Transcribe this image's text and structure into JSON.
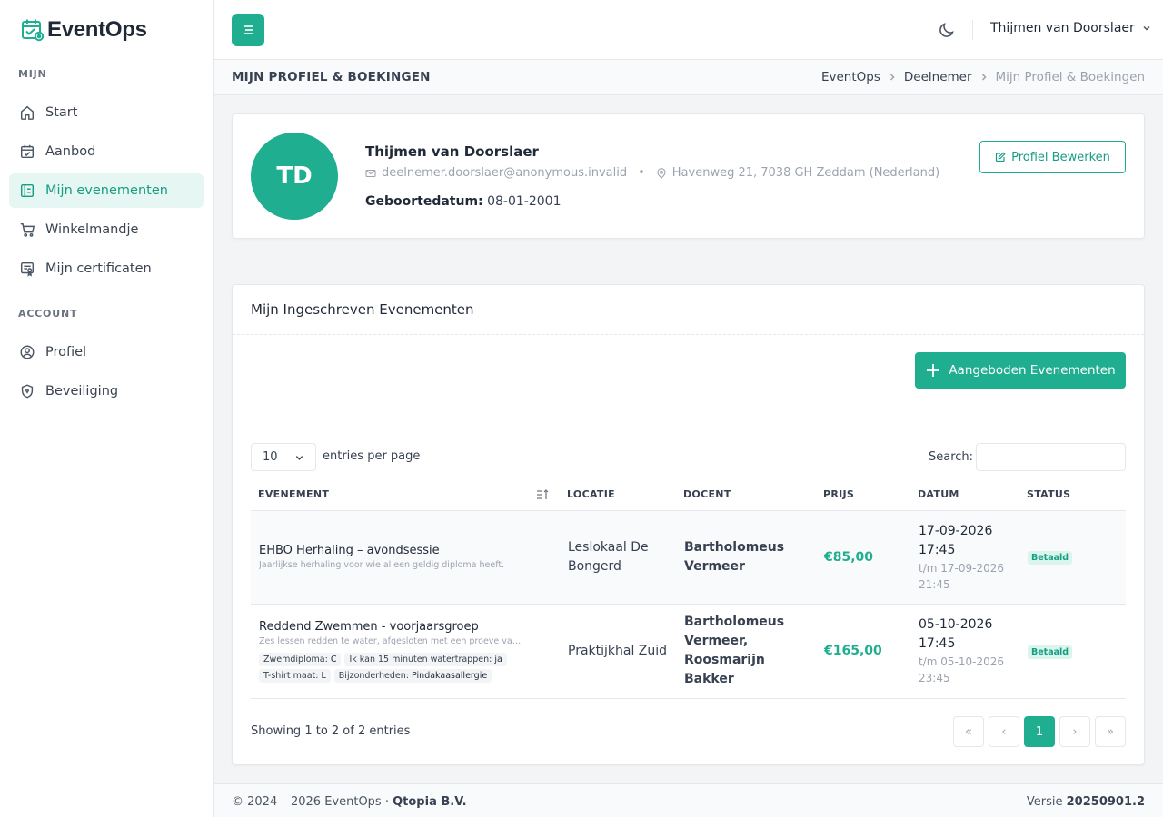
{
  "brand": {
    "name": "EventOps"
  },
  "sidebar": {
    "section_mijn": "MIJN",
    "section_account": "ACCOUNT",
    "items": [
      {
        "label": "Start",
        "icon": "home-icon"
      },
      {
        "label": "Aanbod",
        "icon": "calendar-check-icon"
      },
      {
        "label": "Mijn evenementen",
        "icon": "ticket-icon",
        "active": true
      },
      {
        "label": "Winkelmandje",
        "icon": "cart-icon"
      },
      {
        "label": "Mijn certificaten",
        "icon": "certificate-icon"
      },
      {
        "label": "Profiel",
        "icon": "user-circle-icon"
      },
      {
        "label": "Beveiliging",
        "icon": "shield-icon"
      }
    ]
  },
  "topbar": {
    "user_name": "Thijmen van Doorslaer"
  },
  "subheader": {
    "title": "MIJN PROFIEL & BOEKINGEN",
    "breadcrumb": [
      "EventOps",
      "Deelnemer",
      "Mijn Profiel & Boekingen"
    ]
  },
  "profile": {
    "initials": "TD",
    "name": "Thijmen van Doorslaer",
    "email": "deelnemer.doorslaer@anonymous.invalid",
    "address": "Havenweg 21, 7038 GH Zeddam (Nederland)",
    "dob_label": "Geboortedatum:",
    "dob_value": "08-01-2001",
    "edit_label": "Profiel Bewerken"
  },
  "events": {
    "title": "Mijn Ingeschreven Evenementen",
    "add_label": "Aangeboden Evenementen",
    "page_length": "10",
    "page_length_label": "entries per page",
    "search_label": "Search:",
    "search_value": "",
    "columns": [
      "EVENEMENT",
      "LOCATIE",
      "DOCENT",
      "PRIJS",
      "DATUM",
      "STATUS"
    ],
    "rows": [
      {
        "name": "EHBO Herhaling – avondsessie",
        "desc": "Jaarlijkse herhaling voor wie al een geldig diploma heeft.",
        "tags": [],
        "location": "Leslokaal De Bongerd",
        "teacher": "Bartholomeus Vermeer",
        "price": "€85,00",
        "date_start": "17-09-2026 17:45",
        "date_end": "t/m 17-09-2026 21:45",
        "status": "Betaald"
      },
      {
        "name": "Reddend Zwemmen - voorjaarsgroep",
        "desc": "Zes lessen redden te water, afgesloten met een proeve van ...",
        "tags": [
          {
            "key": "Zwemdiploma:",
            "value": "C"
          },
          {
            "key": "Ik kan 15 minuten watertrappen:",
            "value": "ja"
          },
          {
            "key": "T-shirt maat:",
            "value": "L"
          },
          {
            "key": "Bijzonderheden:",
            "value": "Pindakaasallergie"
          }
        ],
        "location": "Praktijkhal Zuid",
        "teacher": "Bartholomeus Vermeer, Roosmarijn Bakker",
        "price": "€165,00",
        "date_start": "05-10-2026 17:45",
        "date_end": "t/m 05-10-2026 23:45",
        "status": "Betaald"
      }
    ],
    "showing": "Showing 1 to 2 of 2 entries",
    "pagination": {
      "first": "«",
      "prev": "‹",
      "current": "1",
      "next": "›",
      "last": "»"
    }
  },
  "footer": {
    "copy": "© 2024 – 2026 EventOps ·",
    "company": "Qtopia B.V.",
    "version_label": "Versie",
    "version": "20250901.2"
  },
  "colors": {
    "accent": "#1fae8f",
    "accent_light": "#e6f6f2"
  }
}
